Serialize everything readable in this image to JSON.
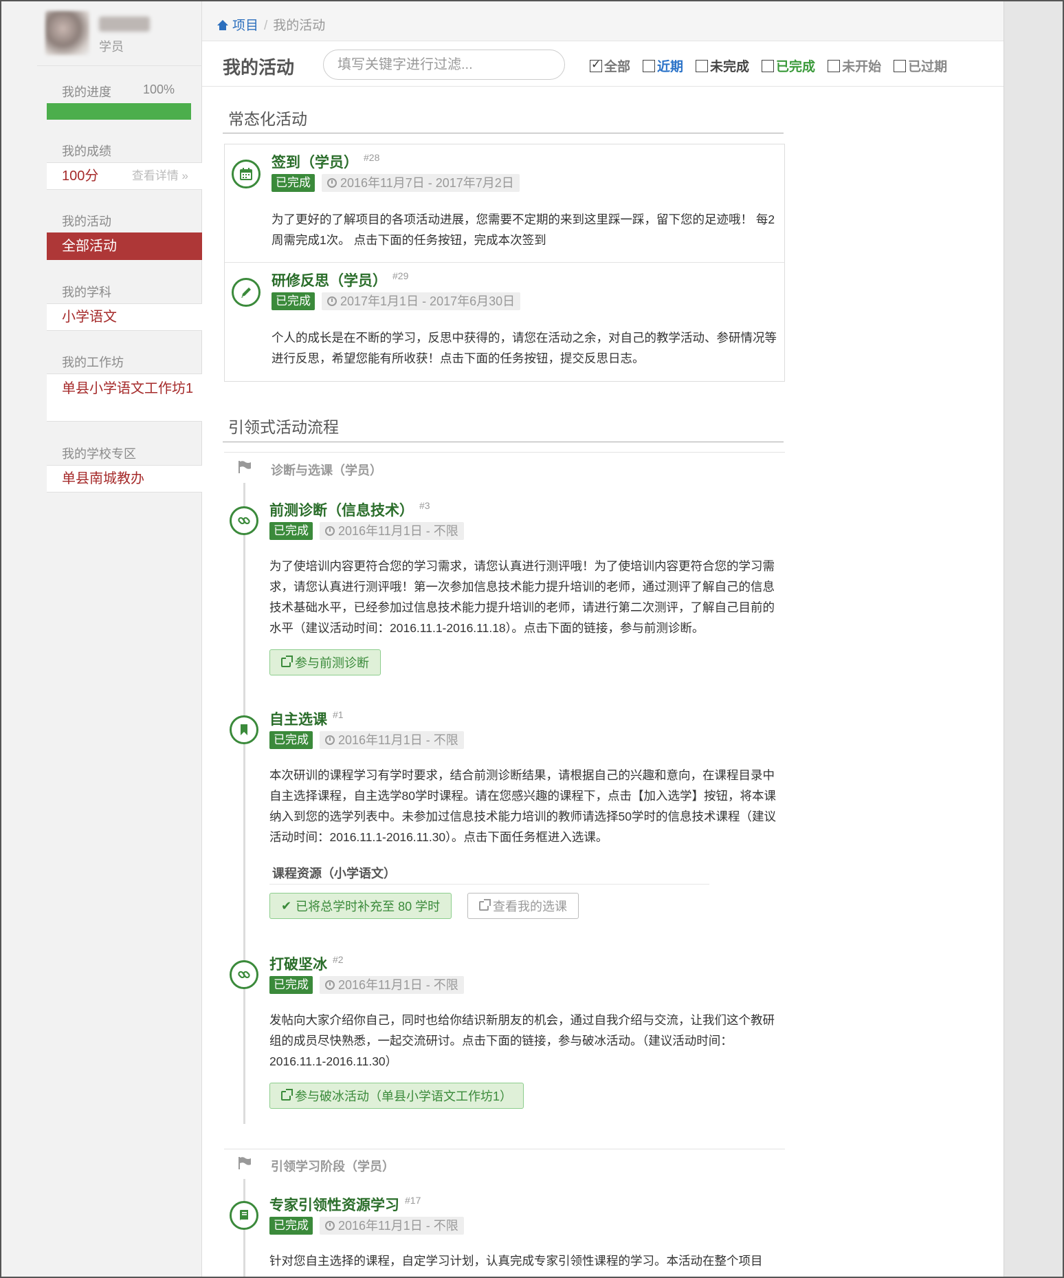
{
  "user": {
    "role": "学员"
  },
  "sidebar": {
    "progress_label": "我的进度",
    "progress_value": "100%",
    "progress_fraction": 1.0,
    "score_label": "我的成绩",
    "score_value": "100分",
    "score_detail": "查看详情 »",
    "activity_label": "我的活动",
    "activity_item": "全部活动",
    "subject_label": "我的学科",
    "subject_item": "小学语文",
    "workshop_label": "我的工作坊",
    "workshop_item": "单县小学语文工作坊1",
    "school_label": "我的学校专区",
    "school_item": "单县南城教办"
  },
  "breadcrumb": {
    "home": "项目",
    "current": "我的活动"
  },
  "toolbar": {
    "title": "我的活动",
    "search_placeholder": "填写关键字进行过滤...",
    "filters": [
      {
        "label": "全部",
        "checked": true
      },
      {
        "label": "近期",
        "checked": false
      },
      {
        "label": "未完成",
        "checked": false
      },
      {
        "label": "已完成",
        "checked": false
      },
      {
        "label": "未开始",
        "checked": false
      },
      {
        "label": "已过期",
        "checked": false
      }
    ]
  },
  "sections": {
    "regular": "常态化活动",
    "guided": "引领式活动流程"
  },
  "regular_activities": [
    {
      "title": "签到（学员）",
      "num": "#28",
      "status": "已完成",
      "date": "2016年11月7日 - 2017年7月2日",
      "icon": "calendar-icon",
      "desc": "为了更好的了解项目的各项活动进展，您需要不定期的来到这里踩一踩，留下您的足迹哦！ 每2周需完成1次。 点击下面的任务按钮，完成本次签到"
    },
    {
      "title": "研修反思（学员）",
      "num": "#29",
      "status": "已完成",
      "date": "2017年1月1日 - 2017年6月30日",
      "icon": "pencil-icon",
      "desc": "个人的成长是在不断的学习，反思中获得的，请您在活动之余，对自己的教学活动、参研情况等进行反思，希望您能有所收获！点击下面的任务按钮，提交反思日志。"
    }
  ],
  "stages": [
    {
      "title": "诊断与选课（学员）"
    },
    {
      "title": "引领学习阶段（学员）"
    }
  ],
  "guided_activities": [
    {
      "title": "前测诊断（信息技术）",
      "num": "#3",
      "status": "已完成",
      "date": "2016年11月1日 - 不限",
      "icon": "link-icon",
      "desc": "为了使培训内容更符合您的学习需求，请您认真进行测评哦！为了使培训内容更符合您的学习需求，请您认真进行测评哦！第一次参加信息技术能力提升培训的老师，通过测评了解自己的信息技术基础水平，已经参加过信息技术能力提升培训的老师，请进行第二次测评，了解自己目前的水平（建议活动时间：2016.11.1-2016.11.18）。点击下面的链接，参与前测诊断。",
      "button": "参与前测诊断"
    },
    {
      "title": "自主选课",
      "num": "#1",
      "status": "已完成",
      "date": "2016年11月1日 - 不限",
      "icon": "bookmark-icon",
      "desc": "本次研训的课程学习有学时要求，结合前测诊断结果，请根据自己的兴趣和意向，在课程目录中自主选择课程，自主选学80学时课程。请在您感兴趣的课程下，点击【加入选学】按钮，将本课纳入到您的选学列表中。未参加过信息技术能力培训的教师请选择50学时的信息技术课程（建议活动时间：2016.11.1-2016.11.30）。点击下面任务框进入选课。",
      "resource_title": "课程资源（小学语文）",
      "button_done": "已将总学时补充至 80 学时",
      "button_view": "查看我的选课"
    },
    {
      "title": "打破坚冰",
      "num": "#2",
      "status": "已完成",
      "date": "2016年11月1日 - 不限",
      "icon": "link-icon",
      "desc": "发帖向大家介绍你自己，同时也给你结识新朋友的机会，通过自我介绍与交流，让我们这个教研组的成员尽快熟悉，一起交流研讨。点击下面的链接，参与破冰活动。（建议活动时间：2016.11.1-2016.11.30）",
      "button": "参与破冰活动（单县小学语文工作坊1）"
    },
    {
      "title": "专家引领性资源学习",
      "num": "#17",
      "status": "已完成",
      "date": "2016年11月1日 - 不限",
      "icon": "book-icon",
      "desc": "针对您自主选择的课程，自定学习计划，认真完成专家引领性课程的学习。本活动在整个项目"
    }
  ],
  "colors": {
    "accent_green": "#3b8a3b",
    "active_red": "#ae3737",
    "link_blue": "#2c6fbd"
  }
}
